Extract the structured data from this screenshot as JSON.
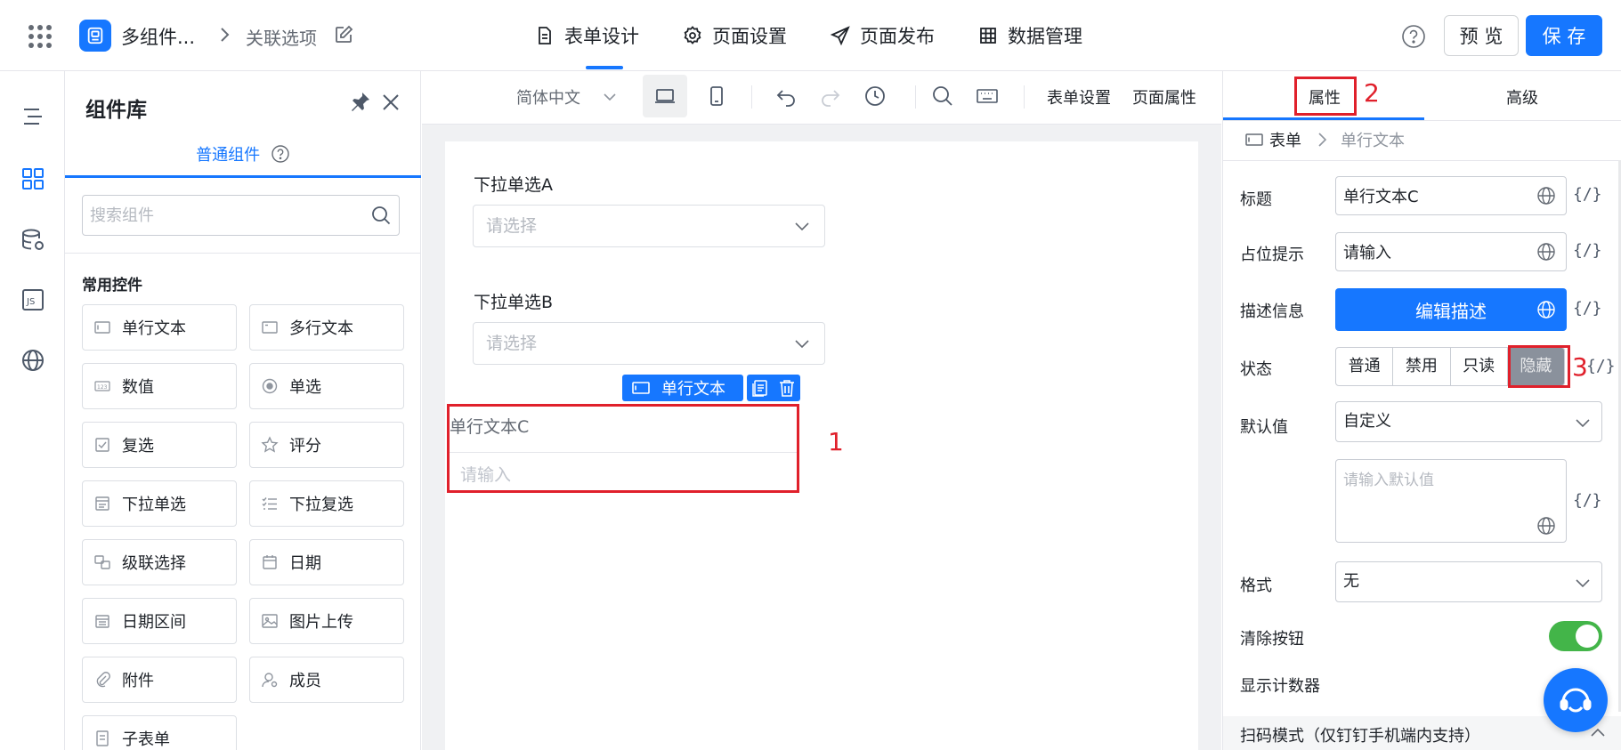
{
  "header": {
    "app_name": "多组件...",
    "page_name": "关联选项",
    "tabs": [
      {
        "label": "表单设计",
        "icon": "document-icon",
        "active": true
      },
      {
        "label": "页面设置",
        "icon": "gear-icon"
      },
      {
        "label": "页面发布",
        "icon": "send-icon"
      },
      {
        "label": "数据管理",
        "icon": "table-icon"
      }
    ],
    "preview_label": "预 览",
    "save_label": "保 存"
  },
  "library": {
    "title": "组件库",
    "tab_label": "普通组件",
    "search_placeholder": "搜索组件",
    "section_title": "常用控件",
    "components": [
      {
        "label": "单行文本",
        "icon": "text-input-icon"
      },
      {
        "label": "多行文本",
        "icon": "textarea-icon"
      },
      {
        "label": "数值",
        "icon": "number-icon"
      },
      {
        "label": "单选",
        "icon": "radio-icon"
      },
      {
        "label": "复选",
        "icon": "checkbox-icon"
      },
      {
        "label": "评分",
        "icon": "star-icon"
      },
      {
        "label": "下拉单选",
        "icon": "dropdown-icon"
      },
      {
        "label": "下拉复选",
        "icon": "checklist-icon"
      },
      {
        "label": "级联选择",
        "icon": "cascade-icon"
      },
      {
        "label": "日期",
        "icon": "calendar-icon"
      },
      {
        "label": "日期区间",
        "icon": "date-range-icon"
      },
      {
        "label": "图片上传",
        "icon": "image-icon"
      },
      {
        "label": "附件",
        "icon": "paperclip-icon"
      },
      {
        "label": "成员",
        "icon": "user-icon"
      },
      {
        "label": "子表单",
        "icon": "subform-icon"
      }
    ]
  },
  "toolbar": {
    "language": "简体中文",
    "form_settings": "表单设置",
    "page_props": "页面属性"
  },
  "canvas": {
    "fields": [
      {
        "label": "下拉单选A",
        "placeholder": "请选择"
      },
      {
        "label": "下拉单选B",
        "placeholder": "请选择"
      }
    ],
    "selected": {
      "tag": "单行文本",
      "label": "单行文本C",
      "placeholder": "请输入"
    },
    "annotations": [
      "1",
      "2",
      "3"
    ],
    "annotation_color": "#e0202b"
  },
  "props": {
    "tabs": [
      "属性",
      "高级"
    ],
    "breadcrumb": [
      "表单",
      "单行文本"
    ],
    "title_label": "标题",
    "title_value": "单行文本C",
    "placeholder_label": "占位提示",
    "placeholder_value": "请输入",
    "desc_label": "描述信息",
    "desc_button": "编辑描述",
    "state_label": "状态",
    "states": [
      "普通",
      "禁用",
      "只读",
      "隐藏"
    ],
    "active_state": "隐藏",
    "default_label": "默认值",
    "default_mode": "自定义",
    "default_placeholder": "请输入默认值",
    "format_label": "格式",
    "format_value": "无",
    "clear_label": "清除按钮",
    "clear_on": true,
    "counter_label": "显示计数器",
    "scan_label": "扫码模式（仅钉钉手机端内支持）",
    "expr": "{/}"
  },
  "colors": {
    "primary": "#1677ff",
    "toggle_on": "#43b549"
  }
}
